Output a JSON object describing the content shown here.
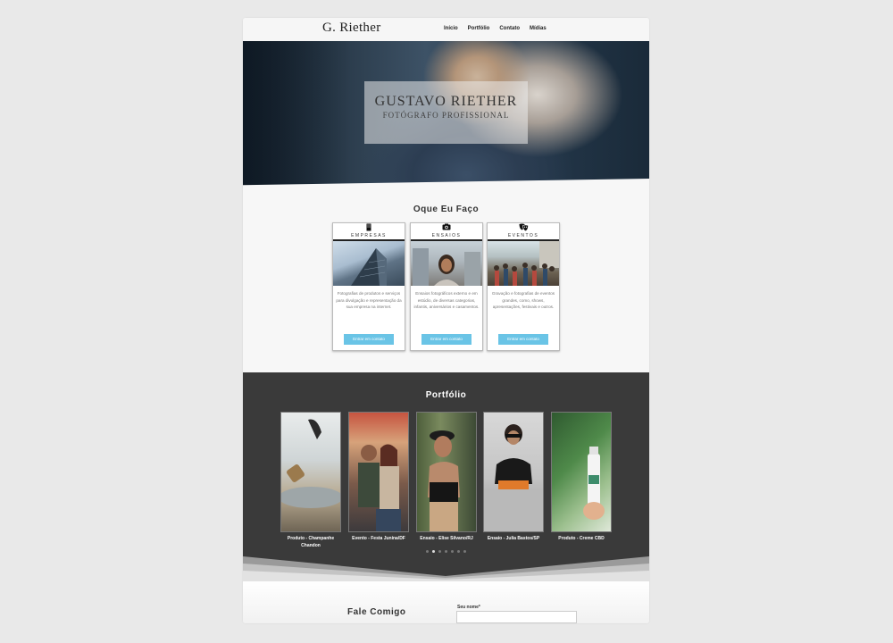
{
  "header": {
    "logo": "G. Riether",
    "nav": [
      "Início",
      "Portfólio",
      "Contato",
      "Mídias"
    ]
  },
  "hero": {
    "title": "GUSTAVO RIETHER",
    "subtitle": "FOTÓGRAFO PROFISSIONAL"
  },
  "services": {
    "title": "Oque Eu Faço",
    "cards": [
      {
        "name": "EMPRESAS",
        "icon": "building-icon",
        "desc": "Fotografias de produtos e serviços para divulgação e representação da sua empresa na internet.",
        "button": "Entrar em contato"
      },
      {
        "name": "ENSAIOS",
        "icon": "camera-icon",
        "desc": "Ensaios fotográficos externo e em estúdio, de diversas categorias, infantis, aniversários e casamentos.",
        "button": "Entrar em contato"
      },
      {
        "name": "EVENTOS",
        "icon": "theater-masks-icon",
        "desc": "Gravação e fotografias de eventos grandes, como, shows, apresentações, festivais e outros.",
        "button": "Entrar em contato"
      }
    ]
  },
  "portfolio": {
    "title": "Portfólio",
    "items": [
      {
        "caption": "Produto - Champanhe Chandon"
      },
      {
        "caption": "Evento - Festa Junina/DF"
      },
      {
        "caption": "Ensaio - Elise Silvano/RJ"
      },
      {
        "caption": "Ensaio - Julia Bastos/SP"
      },
      {
        "caption": "Produto - Creme CBD"
      }
    ],
    "dots": 7,
    "active_dot": 1
  },
  "contact": {
    "title": "Fale Comigo",
    "name_label": "Seu nome*"
  },
  "colors": {
    "button": "#6ac4e6",
    "portfolio_bg": "#3a3a3a",
    "page_bg": "#e9e9e9"
  }
}
